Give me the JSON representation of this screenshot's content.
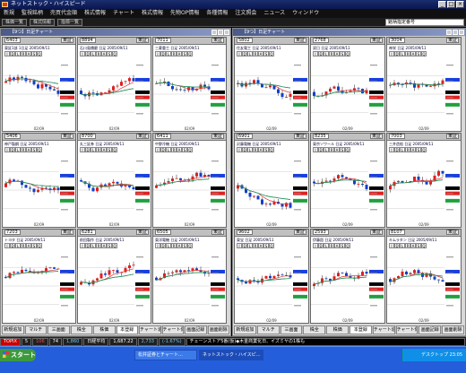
{
  "window": {
    "title": "ネットストック・ハイスピード",
    "controls": [
      "_",
      "□",
      "×"
    ]
  },
  "menu": [
    "新規",
    "監視銘柄",
    "売買代金順",
    "株式情報",
    "チャート",
    "株式情報",
    "先物OP情報",
    "各種情報",
    "注文照会",
    "ニュース",
    "ウィンドウ"
  ],
  "toolbar": {
    "buttons": [
      "株価一覧",
      "株式情報",
      "指標一覧"
    ],
    "code_label": "銘柄指定番号"
  },
  "left_panel": {
    "title": "【9つ】日足チャート",
    "cells": [
      {
        "code": "6403",
        "market": "東証",
        "info": "東証1部 1日足 2005/09/11"
      },
      {
        "code": "8894",
        "market": "東証",
        "info": "石川島播磨 日足 2005/09/11"
      },
      {
        "code": "7011",
        "market": "東証",
        "info": "三菱重工 日足 2005/09/11"
      },
      {
        "code": "5406",
        "market": "東証",
        "info": "神戸製鋼 日足 2005/09/11"
      },
      {
        "code": "8700",
        "market": "東証",
        "info": "丸三証券 日足 2005/09/11"
      },
      {
        "code": "6411",
        "market": "東証",
        "info": "中野冷機 日足 2005/09/11"
      },
      {
        "code": "7203",
        "market": "東証",
        "info": "トヨタ 日足 2005/09/11"
      },
      {
        "code": "6281",
        "market": "東証",
        "info": "前田製作 日足 2005/09/11"
      },
      {
        "code": "6505",
        "market": "東証",
        "info": "東洋電機 日足 2005/09/11"
      }
    ],
    "footer": [
      "新規追加",
      "マルチ",
      "三画面",
      "株全",
      "株価",
      "本登録",
      "チャート追加",
      "チャート保存",
      "画面記録",
      "画面削除"
    ],
    "footer_active": 5
  },
  "right_panel": {
    "title": "【9つ】日足チャート",
    "cells": [
      {
        "code": "5802",
        "market": "東証",
        "info": "住友電工 日足 2005/09/11"
      },
      {
        "code": "2768",
        "market": "東証",
        "info": "双日 日足 2005/09/11"
      },
      {
        "code": "3004",
        "market": "東証",
        "info": "神栄 日足 2005/09/11"
      },
      {
        "code": "6901",
        "market": "東証",
        "info": "沢藤電機 日足 2005/09/11"
      },
      {
        "code": "8235",
        "market": "東証",
        "info": "東京ソワール 日足 2005/09/11"
      },
      {
        "code": "7003",
        "market": "東証",
        "info": "三井造船 日足 2005/09/11"
      },
      {
        "code": "9602",
        "market": "東証",
        "info": "東宝 日足 2005/09/11"
      },
      {
        "code": "2593",
        "market": "東証",
        "info": "伊藤園 日足 2005/09/11"
      },
      {
        "code": "8107",
        "market": "東証",
        "info": "キムラタン 日足 2005/09/11"
      }
    ],
    "footer": [
      "新規追加",
      "マルチ",
      "三画面",
      "株全",
      "株価",
      "本登録",
      "チャート追加",
      "チャート保存",
      "画面記録",
      "画面削除"
    ],
    "footer_active": 5
  },
  "chart_buttons": [
    "I",
    "D",
    "L",
    "R",
    "A",
    "S",
    "Q"
  ],
  "x_tick": "02/09",
  "ticker": {
    "label": "TOPIX",
    "items": [
      "5",
      "106",
      "74",
      "1,860",
      "日経平均",
      "1,687.22",
      "2,733",
      "(-1.67%)"
    ],
    "news": "チェーンストア5番(仮)◆木金商業化日、イズミヤの1株も"
  },
  "taskbar": {
    "start": "スタート",
    "buttons": [
      "松井証券とチャート…",
      "ネットストック・ハイスピ…"
    ],
    "tray": "デスクトップ 23:05"
  }
}
